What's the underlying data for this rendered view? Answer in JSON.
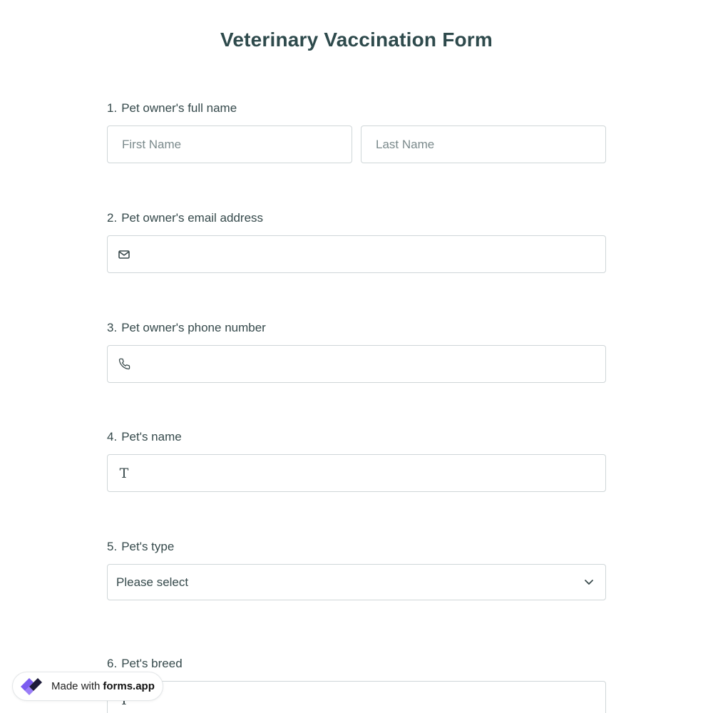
{
  "form": {
    "title": "Veterinary Vaccination Form"
  },
  "questions": [
    {
      "number": "1.",
      "label": "Pet owner's full name",
      "first_placeholder": "First Name",
      "last_placeholder": "Last Name"
    },
    {
      "number": "2.",
      "label": "Pet owner's email address",
      "placeholder": "",
      "icon": "envelope-icon"
    },
    {
      "number": "3.",
      "label": "Pet owner's phone number",
      "placeholder": "",
      "icon": "phone-icon"
    },
    {
      "number": "4.",
      "label": "Pet's name",
      "placeholder": "",
      "icon": "text-icon"
    },
    {
      "number": "5.",
      "label": "Pet's type",
      "selected": "Please select",
      "icon": "chevron-down-icon"
    },
    {
      "number": "6.",
      "label": "Pet's breed",
      "icon": "text-icon"
    }
  ],
  "badge": {
    "made_with": "Made with",
    "brand": "forms.app",
    "logo_icon": "forms-app-logo-icon",
    "colors": {
      "logo_purple": "#7b5cf0",
      "logo_dark": "#1d1b3a"
    }
  },
  "colors": {
    "title": "#2e4a4c",
    "label": "#35494b",
    "border": "#cfd6d8",
    "placeholder": "#7b8a8c"
  }
}
